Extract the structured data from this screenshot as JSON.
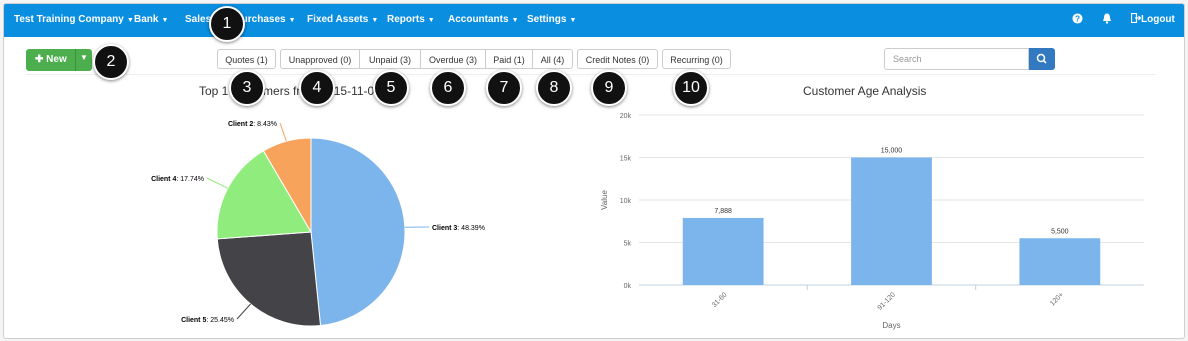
{
  "navbar": {
    "company": "Test Training Company",
    "items": [
      "Bank",
      "Sales",
      "Purchases",
      "Fixed Assets",
      "Reports",
      "Accountants",
      "Settings"
    ],
    "logout": "Logout"
  },
  "toolbar": {
    "new_label": "New",
    "tabs": [
      "Quotes (1)",
      "Unapproved (0)",
      "Unpaid (3)",
      "Overdue (3)",
      "Paid (1)",
      "All (4)",
      "Credit Notes (0)",
      "Recurring (0)"
    ],
    "search_placeholder": "Search"
  },
  "callouts": [
    "1",
    "2",
    "3",
    "4",
    "5",
    "6",
    "7",
    "8",
    "9",
    "10"
  ],
  "pie_title": "Top 1 Customers from 2015-11-01",
  "bar_title": "Customer Age Analysis",
  "chart_data": [
    {
      "type": "pie",
      "title": "Top 1 Customers from 2015-11-01",
      "slices": [
        {
          "name": "Client 3",
          "value": 48.39,
          "label": "48.39%",
          "color": "#7cb5ec"
        },
        {
          "name": "Client 5",
          "value": 25.45,
          "label": "25.45%",
          "color": "#434348"
        },
        {
          "name": "Client 4",
          "value": 17.74,
          "label": "17.74%",
          "color": "#90ed7d"
        },
        {
          "name": "Client 2",
          "value": 8.43,
          "label": "8.43%",
          "color": "#f7a35c"
        }
      ]
    },
    {
      "type": "bar",
      "title": "Customer Age Analysis",
      "categories": [
        "31-60",
        "91-120",
        "120+"
      ],
      "values": [
        7888,
        15000,
        5500
      ],
      "data_labels": [
        "7,888",
        "15,000",
        "5,500"
      ],
      "yticks": [
        "0k",
        "5k",
        "10k",
        "15k",
        "20k"
      ],
      "ylim": [
        0,
        20000
      ],
      "xlabel": "Days",
      "ylabel": "Value",
      "color": "#7cb5ec"
    }
  ]
}
